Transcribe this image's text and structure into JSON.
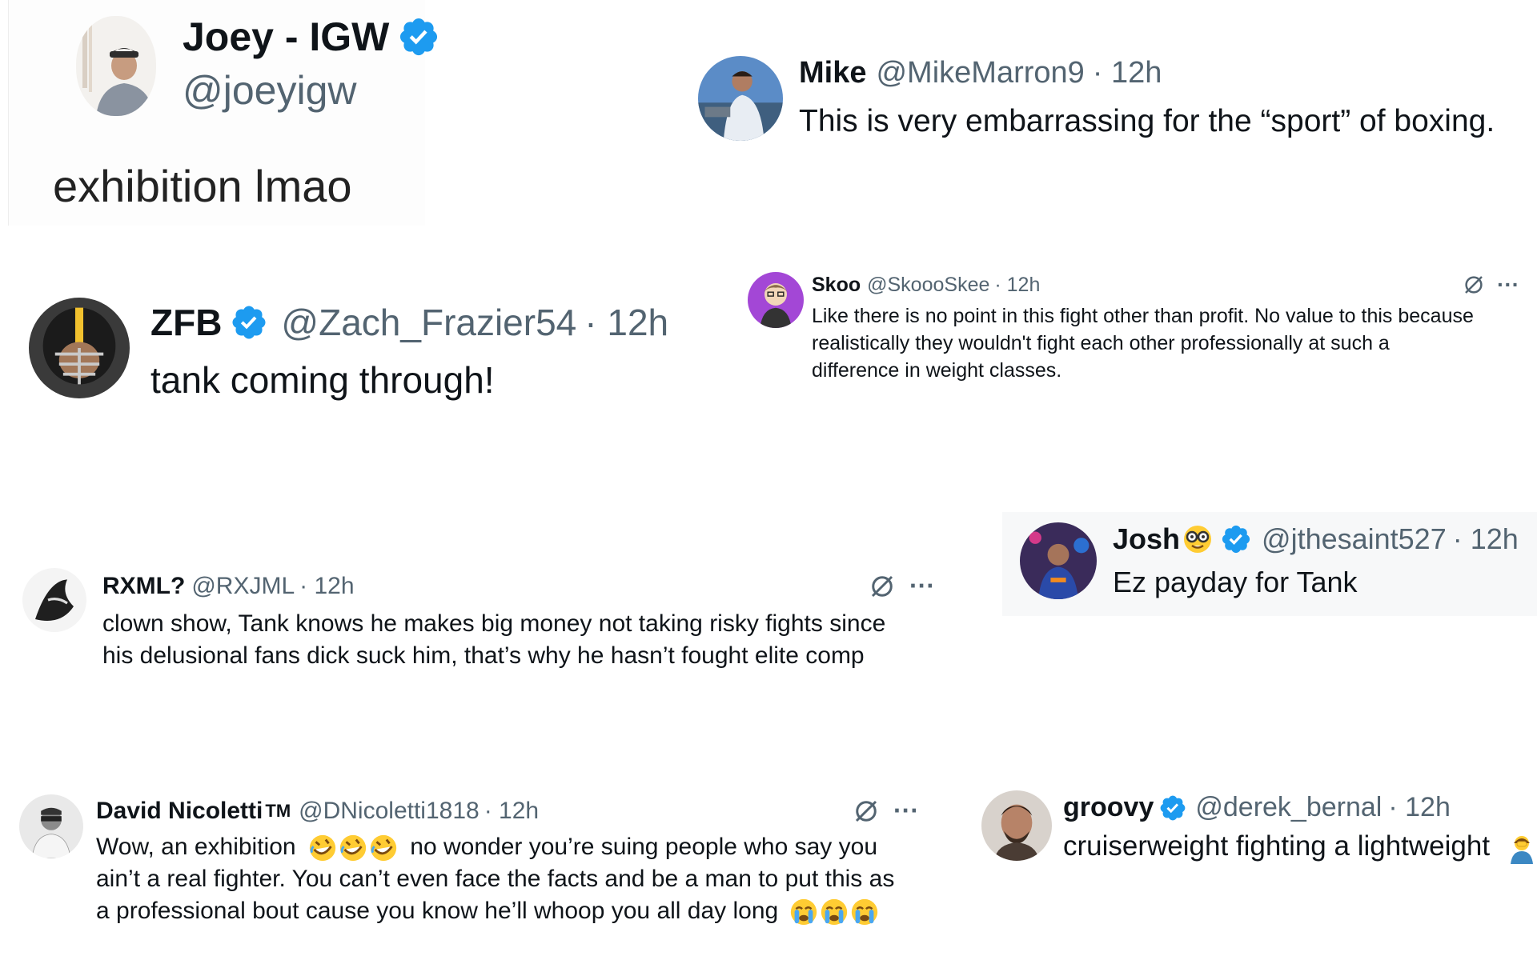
{
  "colors": {
    "verified": "#1d9bf0",
    "text": "#0f1419",
    "secondary": "#536471"
  },
  "tweets": [
    {
      "name": "Joey - IGW",
      "handle": "@joeyigw",
      "verified": true,
      "text": "exhibition lmao"
    },
    {
      "name": "Mike",
      "handle": "@MikeMarron9",
      "time": "· 12h",
      "text": "This is very embarrassing for the “sport” of boxing."
    },
    {
      "name": "ZFB",
      "handle": "@Zach_Frazier54",
      "time": "· 12h",
      "verified": true,
      "text": "tank coming through!"
    },
    {
      "name": "Skoo",
      "handle": "@SkoooSkee",
      "time": "· 12h",
      "text_lines": [
        "Like there is no point in this fight other than profit. No value to this because",
        "realistically they wouldn't fight each other professionally at such a",
        "difference in weight classes."
      ],
      "more": "···"
    },
    {
      "name": "RXML?",
      "handle": "@RXJML",
      "time": "· 12h",
      "text_lines": [
        "clown show, Tank knows he makes big money not taking risky fights since",
        "his delusional fans dick suck him, that’s why he hasn’t fought elite comp"
      ],
      "more": "···"
    },
    {
      "name": "Josh",
      "handle": "@jthesaint527",
      "time": "· 12h",
      "verified": true,
      "text": "Ez payday for Tank"
    },
    {
      "name": "David Nicoletti",
      "name_suffix": "TM",
      "handle": "@DNicoletti1818",
      "time": "· 12h",
      "line1_a": "Wow, an exhibition",
      "line1_b": "no wonder you’re suing people who say you",
      "line2": "ain’t a real fighter. You can’t even face the facts and be a man to put this as",
      "line3": "a professional bout cause you know he’ll whoop you all day long",
      "more": "···"
    },
    {
      "name": "groovy",
      "handle": "@derek_bernal",
      "time": "· 12h",
      "verified": true,
      "text": "cruiserweight fighting a lightweight"
    }
  ]
}
